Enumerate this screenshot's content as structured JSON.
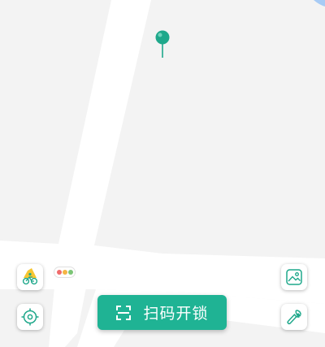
{
  "map": {
    "road_color": "#ffffff",
    "block_color": "#f3f3f3",
    "water_color": "#a7cbf5",
    "pin_color": "#1fa88b"
  },
  "controls": {
    "bike_icon": "bike-ride-icon",
    "locate_icon": "locate-target-icon",
    "gallery_icon": "picture-icon",
    "repair_icon": "wrench-icon",
    "traffic_icon": "traffic-light-icon",
    "traffic_colors": [
      "#f06b6b",
      "#f5b544",
      "#7cc576"
    ]
  },
  "scan": {
    "label": "扫码开锁",
    "color": "#1fb394"
  }
}
